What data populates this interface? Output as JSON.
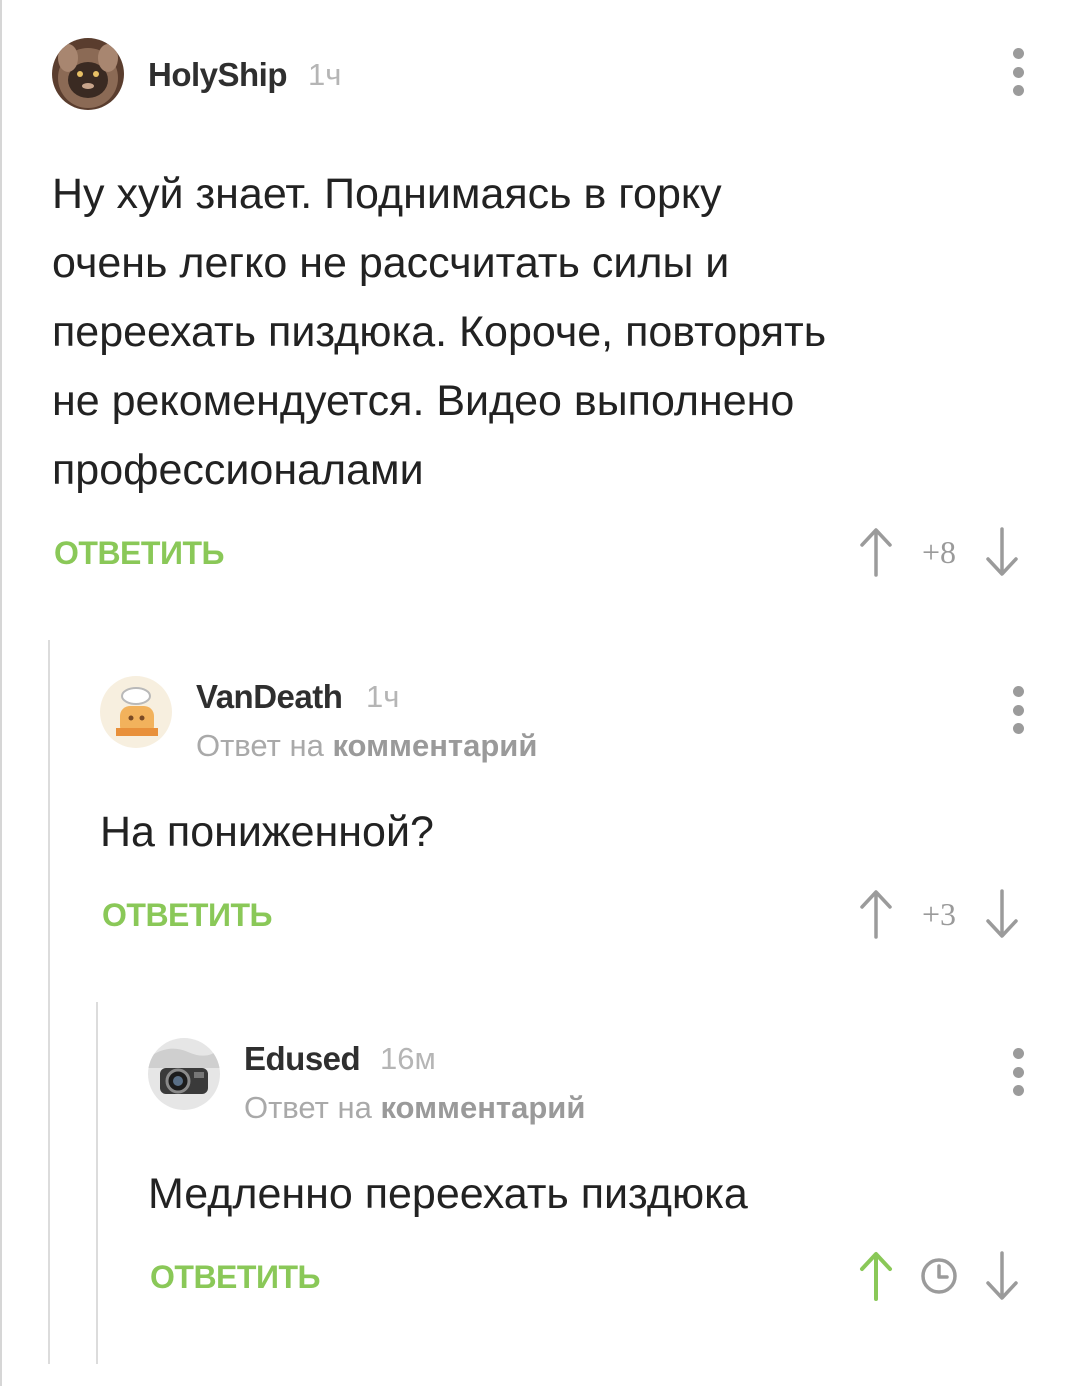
{
  "comments": [
    {
      "username": "HolyShip",
      "time": "1ч",
      "text": "Ну хуй знает. Поднимаясь в горку\nочень легко не рассчитать силы и\nпереехать пиздюка. Короче, повторять\nне рекомендуется. Видео выполнено\nпрофессионалами",
      "reply_label": "ОТВЕТИТЬ",
      "score": "+8"
    },
    {
      "username": "VanDeath",
      "time": "1ч",
      "reply_prefix": "Ответ на",
      "reply_target": "комментарий",
      "text": "На пониженной?",
      "reply_label": "ОТВЕТИТЬ",
      "score": "+3"
    },
    {
      "username": "Edused",
      "time": "16м",
      "reply_prefix": "Ответ на",
      "reply_target": "комментарий",
      "text": "Медленно переехать пиздюка",
      "reply_label": "ОТВЕТИТЬ",
      "score_icon": "clock-icon",
      "upvoted": true
    }
  ],
  "colors": {
    "accent": "#8ac858",
    "icon_gray": "#9b9b9b",
    "text": "#222222"
  },
  "icons": [
    "kebab-menu-icon",
    "upvote-arrow-icon",
    "downvote-arrow-icon",
    "clock-icon",
    "avatar"
  ]
}
